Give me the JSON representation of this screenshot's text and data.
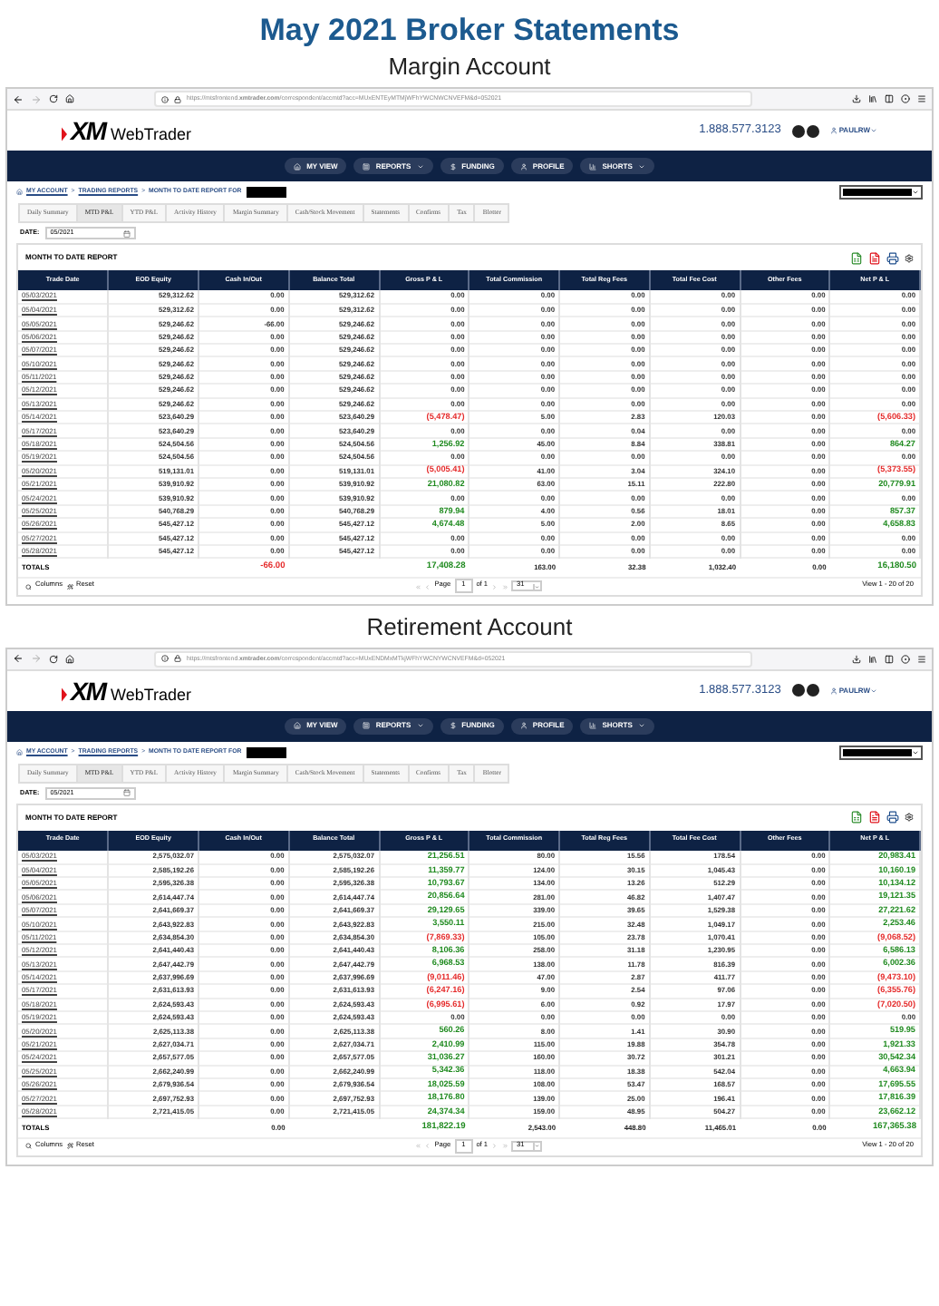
{
  "page_title": "May 2021 Broker Statements",
  "accounts": [
    {
      "heading": "Margin Account",
      "url": "https://mtsfrontend.**xmtrader.com**/correspondent/accmtd?acc=MUxENTEyMTMjWFhYWCNWCNVEFM&d=052021",
      "logo": {
        "mark": "XM",
        "product": "WebTrader"
      },
      "phone": "1.888.577.3123",
      "user": "PAULRW",
      "nav": [
        {
          "label": "MY VIEW",
          "dropdown": false
        },
        {
          "label": "REPORTS",
          "dropdown": true
        },
        {
          "label": "FUNDING",
          "dropdown": false
        },
        {
          "label": "PROFILE",
          "dropdown": false
        },
        {
          "label": "SHORTS",
          "dropdown": true
        }
      ],
      "breadcrumb": [
        "MY ACCOUNT",
        "TRADING REPORTS",
        "MONTH TO DATE REPORT FOR"
      ],
      "separator": ">",
      "tabs": [
        {
          "label": "Daily Summary",
          "selected": false
        },
        {
          "label": "MTD P&L",
          "selected": true
        },
        {
          "label": "YTD P&L",
          "selected": false
        },
        {
          "label": "Activity History",
          "selected": false
        },
        {
          "label": "Margin Summary",
          "selected": false
        },
        {
          "label": "Cash/Stock Movement",
          "selected": false
        },
        {
          "label": "Statements",
          "selected": false
        },
        {
          "label": "Confirms",
          "selected": false
        },
        {
          "label": "Tax",
          "selected": false
        },
        {
          "label": "Blotter",
          "selected": false
        }
      ],
      "date": {
        "label": "DATE:",
        "value": "05/2021"
      },
      "report": {
        "title": "MONTH TO DATE REPORT",
        "columns": [
          "Trade Date",
          "EOD Equity",
          "Cash In/Out",
          "Balance Total",
          "Gross P & L",
          "Total Commission",
          "Total Reg Fees",
          "Total Fee Cost",
          "Other Fees",
          "Net P & L"
        ],
        "rows": [
          {
            "cells": [
              "05/03/2021",
              "529,312.62",
              "0.00",
              "529,312.62",
              "0.00",
              "0.00",
              "0.00",
              "0.00",
              "0.00",
              "0.00"
            ]
          },
          {
            "cells": [
              "05/04/2021",
              "529,312.62",
              "0.00",
              "529,312.62",
              "0.00",
              "0.00",
              "0.00",
              "0.00",
              "0.00",
              "0.00"
            ]
          },
          {
            "cells": [
              "05/05/2021",
              "529,246.62",
              "-66.00",
              "529,246.62",
              "0.00",
              "0.00",
              "0.00",
              "0.00",
              "0.00",
              "0.00"
            ]
          },
          {
            "cells": [
              "05/06/2021",
              "529,246.62",
              "0.00",
              "529,246.62",
              "0.00",
              "0.00",
              "0.00",
              "0.00",
              "0.00",
              "0.00"
            ]
          },
          {
            "cells": [
              "05/07/2021",
              "529,246.62",
              "0.00",
              "529,246.62",
              "0.00",
              "0.00",
              "0.00",
              "0.00",
              "0.00",
              "0.00"
            ]
          },
          {
            "cells": [
              "05/10/2021",
              "529,246.62",
              "0.00",
              "529,246.62",
              "0.00",
              "0.00",
              "0.00",
              "0.00",
              "0.00",
              "0.00"
            ]
          },
          {
            "cells": [
              "05/11/2021",
              "529,246.62",
              "0.00",
              "529,246.62",
              "0.00",
              "0.00",
              "0.00",
              "0.00",
              "0.00",
              "0.00"
            ]
          },
          {
            "cells": [
              "05/12/2021",
              "529,246.62",
              "0.00",
              "529,246.62",
              "0.00",
              "0.00",
              "0.00",
              "0.00",
              "0.00",
              "0.00"
            ]
          },
          {
            "cells": [
              "05/13/2021",
              "529,246.62",
              "0.00",
              "529,246.62",
              "0.00",
              "0.00",
              "0.00",
              "0.00",
              "0.00",
              "0.00"
            ]
          },
          {
            "cells": [
              "05/14/2021",
              "523,640.29",
              "0.00",
              "523,640.29",
              "(5,478.47)",
              "5.00",
              "2.83",
              "120.03",
              "0.00",
              "(5,606.33)"
            ],
            "color": "#e52b2b"
          },
          {
            "cells": [
              "05/17/2021",
              "523,640.29",
              "0.00",
              "523,640.29",
              "0.00",
              "0.00",
              "0.04",
              "0.00",
              "0.00",
              "0.00"
            ]
          },
          {
            "cells": [
              "05/18/2021",
              "524,504.56",
              "0.00",
              "524,504.56",
              "1,256.92",
              "45.00",
              "8.84",
              "338.81",
              "0.00",
              "864.27"
            ],
            "color": "#1f8a1f"
          },
          {
            "cells": [
              "05/19/2021",
              "524,504.56",
              "0.00",
              "524,504.56",
              "0.00",
              "0.00",
              "0.00",
              "0.00",
              "0.00",
              "0.00"
            ]
          },
          {
            "cells": [
              "05/20/2021",
              "519,131.01",
              "0.00",
              "519,131.01",
              "(5,005.41)",
              "41.00",
              "3.04",
              "324.10",
              "0.00",
              "(5,373.55)"
            ],
            "color": "#e52b2b"
          },
          {
            "cells": [
              "05/21/2021",
              "539,910.92",
              "0.00",
              "539,910.92",
              "21,080.82",
              "63.00",
              "15.11",
              "222.80",
              "0.00",
              "20,779.91"
            ],
            "color": "#1f8a1f"
          },
          {
            "cells": [
              "05/24/2021",
              "539,910.92",
              "0.00",
              "539,910.92",
              "0.00",
              "0.00",
              "0.00",
              "0.00",
              "0.00",
              "0.00"
            ]
          },
          {
            "cells": [
              "05/25/2021",
              "540,768.29",
              "0.00",
              "540,768.29",
              "879.94",
              "4.00",
              "0.56",
              "18.01",
              "0.00",
              "857.37"
            ],
            "color": "#1f8a1f"
          },
          {
            "cells": [
              "05/26/2021",
              "545,427.12",
              "0.00",
              "545,427.12",
              "4,674.48",
              "5.00",
              "2.00",
              "8.65",
              "0.00",
              "4,658.83"
            ],
            "color": "#1f8a1f"
          },
          {
            "cells": [
              "05/27/2021",
              "545,427.12",
              "0.00",
              "545,427.12",
              "0.00",
              "0.00",
              "0.00",
              "0.00",
              "0.00",
              "0.00"
            ]
          },
          {
            "cells": [
              "05/28/2021",
              "545,427.12",
              "0.00",
              "545,427.12",
              "0.00",
              "0.00",
              "0.00",
              "0.00",
              "0.00",
              "0.00"
            ]
          }
        ],
        "totals": {
          "label": "TOTALS",
          "cash": {
            "text": "-66.00",
            "color": "#e52b2b"
          },
          "gross": {
            "text": "17,408.28",
            "color": "#1f8a1f"
          },
          "commission": {
            "text": "163.00"
          },
          "reg_fees": {
            "text": "32.38"
          },
          "fee_cost": {
            "text": "1,032.40"
          },
          "other_fees": {
            "text": "0.00"
          },
          "net": {
            "text": "16,180.50",
            "color": "#1f8a1f"
          }
        },
        "footer": {
          "columns_label": "Columns",
          "reset_label": "Reset",
          "page_label": "Page",
          "page": "1",
          "of_label": "of 1",
          "page_size": "31",
          "view_label": "View 1 - 20 of 20"
        }
      }
    },
    {
      "heading": "Retirement Account",
      "url": "https://mtsfrontend.**xmtrader.com**/correspondent/accmtd?acc=MUxENDMxMTkjWFhYWCNYWCNVEFM&d=052021",
      "logo": {
        "mark": "XM",
        "product": "WebTrader"
      },
      "phone": "1.888.577.3123",
      "user": "PAULRW",
      "nav": [
        {
          "label": "MY VIEW",
          "dropdown": false
        },
        {
          "label": "REPORTS",
          "dropdown": true
        },
        {
          "label": "FUNDING",
          "dropdown": false
        },
        {
          "label": "PROFILE",
          "dropdown": false
        },
        {
          "label": "SHORTS",
          "dropdown": true
        }
      ],
      "breadcrumb": [
        "MY ACCOUNT",
        "TRADING REPORTS",
        "MONTH TO DATE REPORT FOR"
      ],
      "separator": ">",
      "tabs": [
        {
          "label": "Daily Summary",
          "selected": false
        },
        {
          "label": "MTD P&L",
          "selected": true
        },
        {
          "label": "YTD P&L",
          "selected": false
        },
        {
          "label": "Activity History",
          "selected": false
        },
        {
          "label": "Margin Summary",
          "selected": false
        },
        {
          "label": "Cash/Stock Movement",
          "selected": false
        },
        {
          "label": "Statements",
          "selected": false
        },
        {
          "label": "Confirms",
          "selected": false
        },
        {
          "label": "Tax",
          "selected": false
        },
        {
          "label": "Blotter",
          "selected": false
        }
      ],
      "date": {
        "label": "DATE:",
        "value": "05/2021"
      },
      "report": {
        "title": "MONTH TO DATE REPORT",
        "columns": [
          "Trade Date",
          "EOD Equity",
          "Cash In/Out",
          "Balance Total",
          "Gross P & L",
          "Total Commission",
          "Total Reg Fees",
          "Total Fee Cost",
          "Other Fees",
          "Net P & L"
        ],
        "rows": [
          {
            "cells": [
              "05/03/2021",
              "2,575,032.07",
              "0.00",
              "2,575,032.07",
              "21,256.51",
              "80.00",
              "15.56",
              "178.54",
              "0.00",
              "20,983.41"
            ],
            "color": "#1f8a1f"
          },
          {
            "cells": [
              "05/04/2021",
              "2,585,192.26",
              "0.00",
              "2,585,192.26",
              "11,359.77",
              "124.00",
              "30.15",
              "1,045.43",
              "0.00",
              "10,160.19"
            ],
            "color": "#1f8a1f"
          },
          {
            "cells": [
              "05/05/2021",
              "2,595,326.38",
              "0.00",
              "2,595,326.38",
              "10,793.67",
              "134.00",
              "13.26",
              "512.29",
              "0.00",
              "10,134.12"
            ],
            "color": "#1f8a1f"
          },
          {
            "cells": [
              "05/06/2021",
              "2,614,447.74",
              "0.00",
              "2,614,447.74",
              "20,856.64",
              "281.00",
              "46.82",
              "1,407.47",
              "0.00",
              "19,121.35"
            ],
            "color": "#1f8a1f"
          },
          {
            "cells": [
              "05/07/2021",
              "2,641,669.37",
              "0.00",
              "2,641,669.37",
              "29,129.65",
              "339.00",
              "39.65",
              "1,529.38",
              "0.00",
              "27,221.62"
            ],
            "color": "#1f8a1f"
          },
          {
            "cells": [
              "05/10/2021",
              "2,643,922.83",
              "0.00",
              "2,643,922.83",
              "3,550.11",
              "215.00",
              "32.48",
              "1,049.17",
              "0.00",
              "2,253.46"
            ],
            "color": "#1f8a1f"
          },
          {
            "cells": [
              "05/11/2021",
              "2,634,854.30",
              "0.00",
              "2,634,854.30",
              "(7,869.33)",
              "105.00",
              "23.78",
              "1,070.41",
              "0.00",
              "(9,068.52)"
            ],
            "color": "#e52b2b"
          },
          {
            "cells": [
              "05/12/2021",
              "2,641,440.43",
              "0.00",
              "2,641,440.43",
              "8,106.36",
              "258.00",
              "31.18",
              "1,230.95",
              "0.00",
              "6,586.13"
            ],
            "color": "#1f8a1f"
          },
          {
            "cells": [
              "05/13/2021",
              "2,647,442.79",
              "0.00",
              "2,647,442.79",
              "6,968.53",
              "138.00",
              "11.78",
              "816.39",
              "0.00",
              "6,002.36"
            ],
            "color": "#1f8a1f"
          },
          {
            "cells": [
              "05/14/2021",
              "2,637,996.69",
              "0.00",
              "2,637,996.69",
              "(9,011.46)",
              "47.00",
              "2.87",
              "411.77",
              "0.00",
              "(9,473.10)"
            ],
            "color": "#e52b2b"
          },
          {
            "cells": [
              "05/17/2021",
              "2,631,613.93",
              "0.00",
              "2,631,613.93",
              "(6,247.16)",
              "9.00",
              "2.54",
              "97.06",
              "0.00",
              "(6,355.76)"
            ],
            "color": "#e52b2b"
          },
          {
            "cells": [
              "05/18/2021",
              "2,624,593.43",
              "0.00",
              "2,624,593.43",
              "(6,995.61)",
              "6.00",
              "0.92",
              "17.97",
              "0.00",
              "(7,020.50)"
            ],
            "color": "#e52b2b"
          },
          {
            "cells": [
              "05/19/2021",
              "2,624,593.43",
              "0.00",
              "2,624,593.43",
              "0.00",
              "0.00",
              "0.00",
              "0.00",
              "0.00",
              "0.00"
            ]
          },
          {
            "cells": [
              "05/20/2021",
              "2,625,113.38",
              "0.00",
              "2,625,113.38",
              "560.26",
              "8.00",
              "1.41",
              "30.90",
              "0.00",
              "519.95"
            ],
            "color": "#1f8a1f"
          },
          {
            "cells": [
              "05/21/2021",
              "2,627,034.71",
              "0.00",
              "2,627,034.71",
              "2,410.99",
              "115.00",
              "19.88",
              "354.78",
              "0.00",
              "1,921.33"
            ],
            "color": "#1f8a1f"
          },
          {
            "cells": [
              "05/24/2021",
              "2,657,577.05",
              "0.00",
              "2,657,577.05",
              "31,036.27",
              "160.00",
              "30.72",
              "301.21",
              "0.00",
              "30,542.34"
            ],
            "color": "#1f8a1f"
          },
          {
            "cells": [
              "05/25/2021",
              "2,662,240.99",
              "0.00",
              "2,662,240.99",
              "5,342.36",
              "118.00",
              "18.38",
              "542.04",
              "0.00",
              "4,663.94"
            ],
            "color": "#1f8a1f"
          },
          {
            "cells": [
              "05/26/2021",
              "2,679,936.54",
              "0.00",
              "2,679,936.54",
              "18,025.59",
              "108.00",
              "53.47",
              "168.57",
              "0.00",
              "17,695.55"
            ],
            "color": "#1f8a1f"
          },
          {
            "cells": [
              "05/27/2021",
              "2,697,752.93",
              "0.00",
              "2,697,752.93",
              "18,176.80",
              "139.00",
              "25.00",
              "196.41",
              "0.00",
              "17,816.39"
            ],
            "color": "#1f8a1f"
          },
          {
            "cells": [
              "05/28/2021",
              "2,721,415.05",
              "0.00",
              "2,721,415.05",
              "24,374.34",
              "159.00",
              "48.95",
              "504.27",
              "0.00",
              "23,662.12"
            ],
            "color": "#1f8a1f"
          }
        ],
        "totals": {
          "label": "TOTALS",
          "cash": {
            "text": "0.00"
          },
          "gross": {
            "text": "181,822.19",
            "color": "#1f8a1f"
          },
          "commission": {
            "text": "2,543.00"
          },
          "reg_fees": {
            "text": "448.80"
          },
          "fee_cost": {
            "text": "11,465.01"
          },
          "other_fees": {
            "text": "0.00"
          },
          "net": {
            "text": "167,365.38",
            "color": "#1f8a1f"
          }
        },
        "footer": {
          "columns_label": "Columns",
          "reset_label": "Reset",
          "page_label": "Page",
          "page": "1",
          "of_label": "of 1",
          "page_size": "31",
          "view_label": "View 1 - 20 of 20"
        }
      }
    }
  ]
}
